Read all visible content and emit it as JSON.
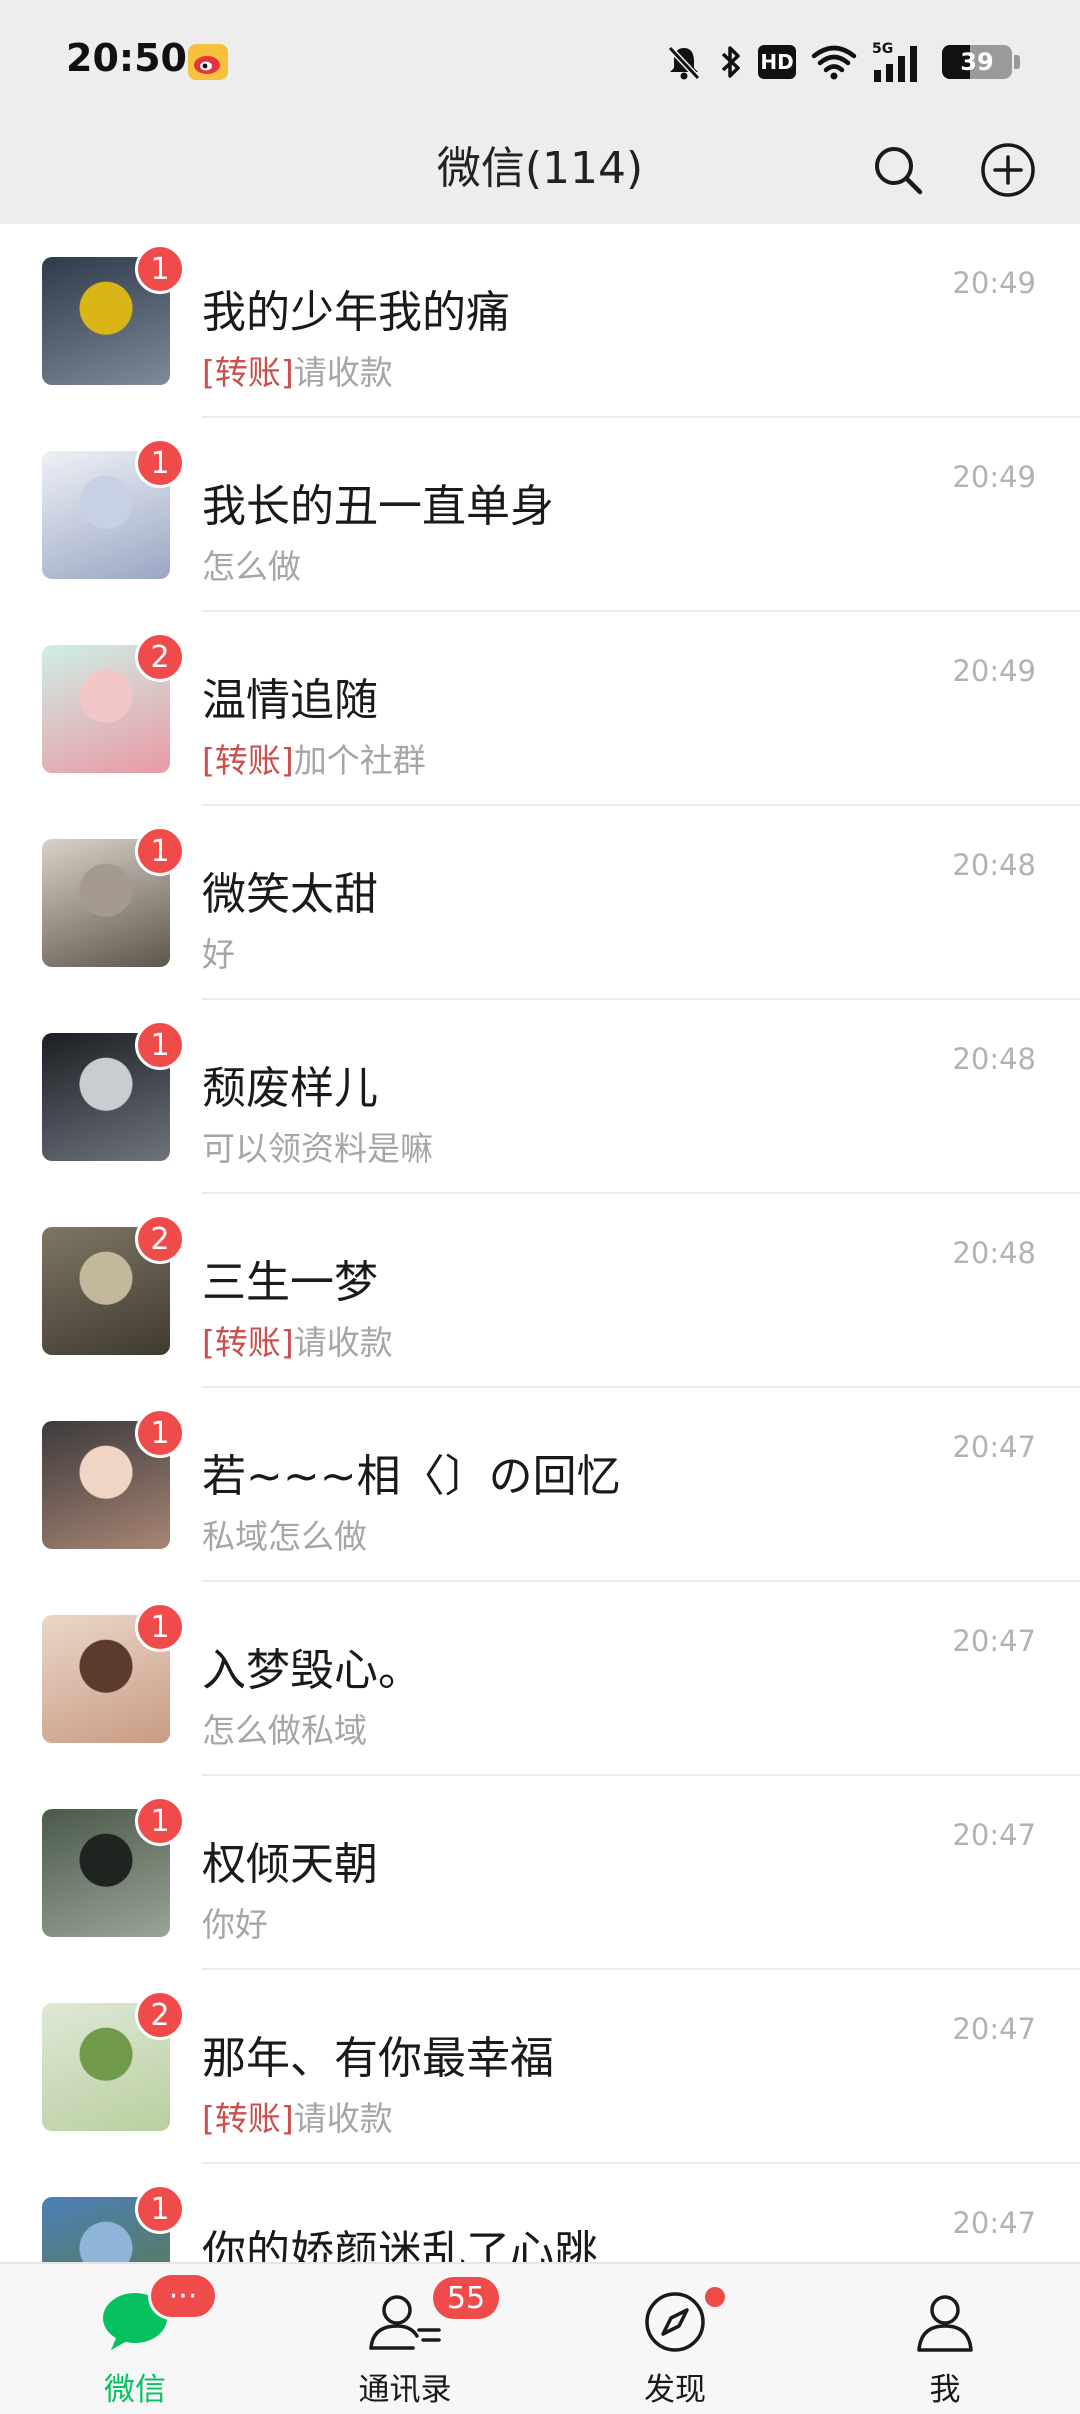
{
  "status_bar": {
    "time": "20:50",
    "battery": "39",
    "network": "5G",
    "hd": "HD"
  },
  "header": {
    "title": "微信(114)"
  },
  "chats": [
    {
      "name": "我的少年我的痛",
      "tag": "[转账]",
      "preview": "请收款",
      "time": "20:49",
      "unread": "1",
      "avatar_colors": [
        "#2f3a4a",
        "#d9b515",
        "#7e8a97"
      ]
    },
    {
      "name": "我长的丑一直单身",
      "tag": "",
      "preview": "怎么做",
      "time": "20:49",
      "unread": "1",
      "avatar_colors": [
        "#eef1f6",
        "#c7d0e4",
        "#9aa7c4"
      ]
    },
    {
      "name": "温情追随",
      "tag": "[转账]",
      "preview": "加个社群",
      "time": "20:49",
      "unread": "2",
      "avatar_colors": [
        "#cfeee6",
        "#f3c6c8",
        "#e89aa4"
      ]
    },
    {
      "name": "微笑太甜",
      "tag": "",
      "preview": "好",
      "time": "20:48",
      "unread": "1",
      "avatar_colors": [
        "#d8d2c8",
        "#a49b8e",
        "#5e564c"
      ]
    },
    {
      "name": "颓废样儿",
      "tag": "",
      "preview": "可以领资料是嘛",
      "time": "20:48",
      "unread": "1",
      "avatar_colors": [
        "#1b1f24",
        "#c9ccd1",
        "#6f747b"
      ]
    },
    {
      "name": "三生一梦",
      "tag": "[转账]",
      "preview": "请收款",
      "time": "20:48",
      "unread": "2",
      "avatar_colors": [
        "#7f7664",
        "#c4b89c",
        "#3f3a31"
      ]
    },
    {
      "name": "若~~~相〈〕の回忆",
      "tag": "",
      "preview": "私域怎么做",
      "time": "20:47",
      "unread": "1",
      "avatar_colors": [
        "#3d3a3c",
        "#f0d4c4",
        "#a88574"
      ]
    },
    {
      "name": "入梦毁心。",
      "tag": "",
      "preview": "怎么做私域",
      "time": "20:47",
      "unread": "1",
      "avatar_colors": [
        "#ead7c8",
        "#5a3b2c",
        "#c99b84"
      ]
    },
    {
      "name": "权倾天朝",
      "tag": "",
      "preview": "你好",
      "time": "20:47",
      "unread": "1",
      "avatar_colors": [
        "#4a5a48",
        "#202421",
        "#9aa49a"
      ]
    },
    {
      "name": "那年、有你最幸福",
      "tag": "[转账]",
      "preview": "请收款",
      "time": "20:47",
      "unread": "2",
      "avatar_colors": [
        "#dfe8d6",
        "#6f9a4a",
        "#b9cfa0"
      ]
    },
    {
      "name": "你的娇颜迷乱了心跳",
      "tag": "",
      "preview": "",
      "time": "20:47",
      "unread": "1",
      "avatar_colors": [
        "#4b7fb8",
        "#8fb4d8",
        "#5d7a3a"
      ]
    }
  ],
  "tabs": [
    {
      "label": "微信",
      "icon": "chat-bubble-icon",
      "badge": "···",
      "active": true
    },
    {
      "label": "通讯录",
      "icon": "contacts-icon",
      "badge": "55",
      "active": false
    },
    {
      "label": "发现",
      "icon": "compass-icon",
      "badge": "",
      "dot": true,
      "active": false
    },
    {
      "label": "我",
      "icon": "person-icon",
      "badge": "",
      "active": false
    }
  ],
  "colors": {
    "accent": "#07c160",
    "badge": "#f04b4b",
    "transfer_tag": "#c9504e",
    "header_bg": "#ededed"
  }
}
